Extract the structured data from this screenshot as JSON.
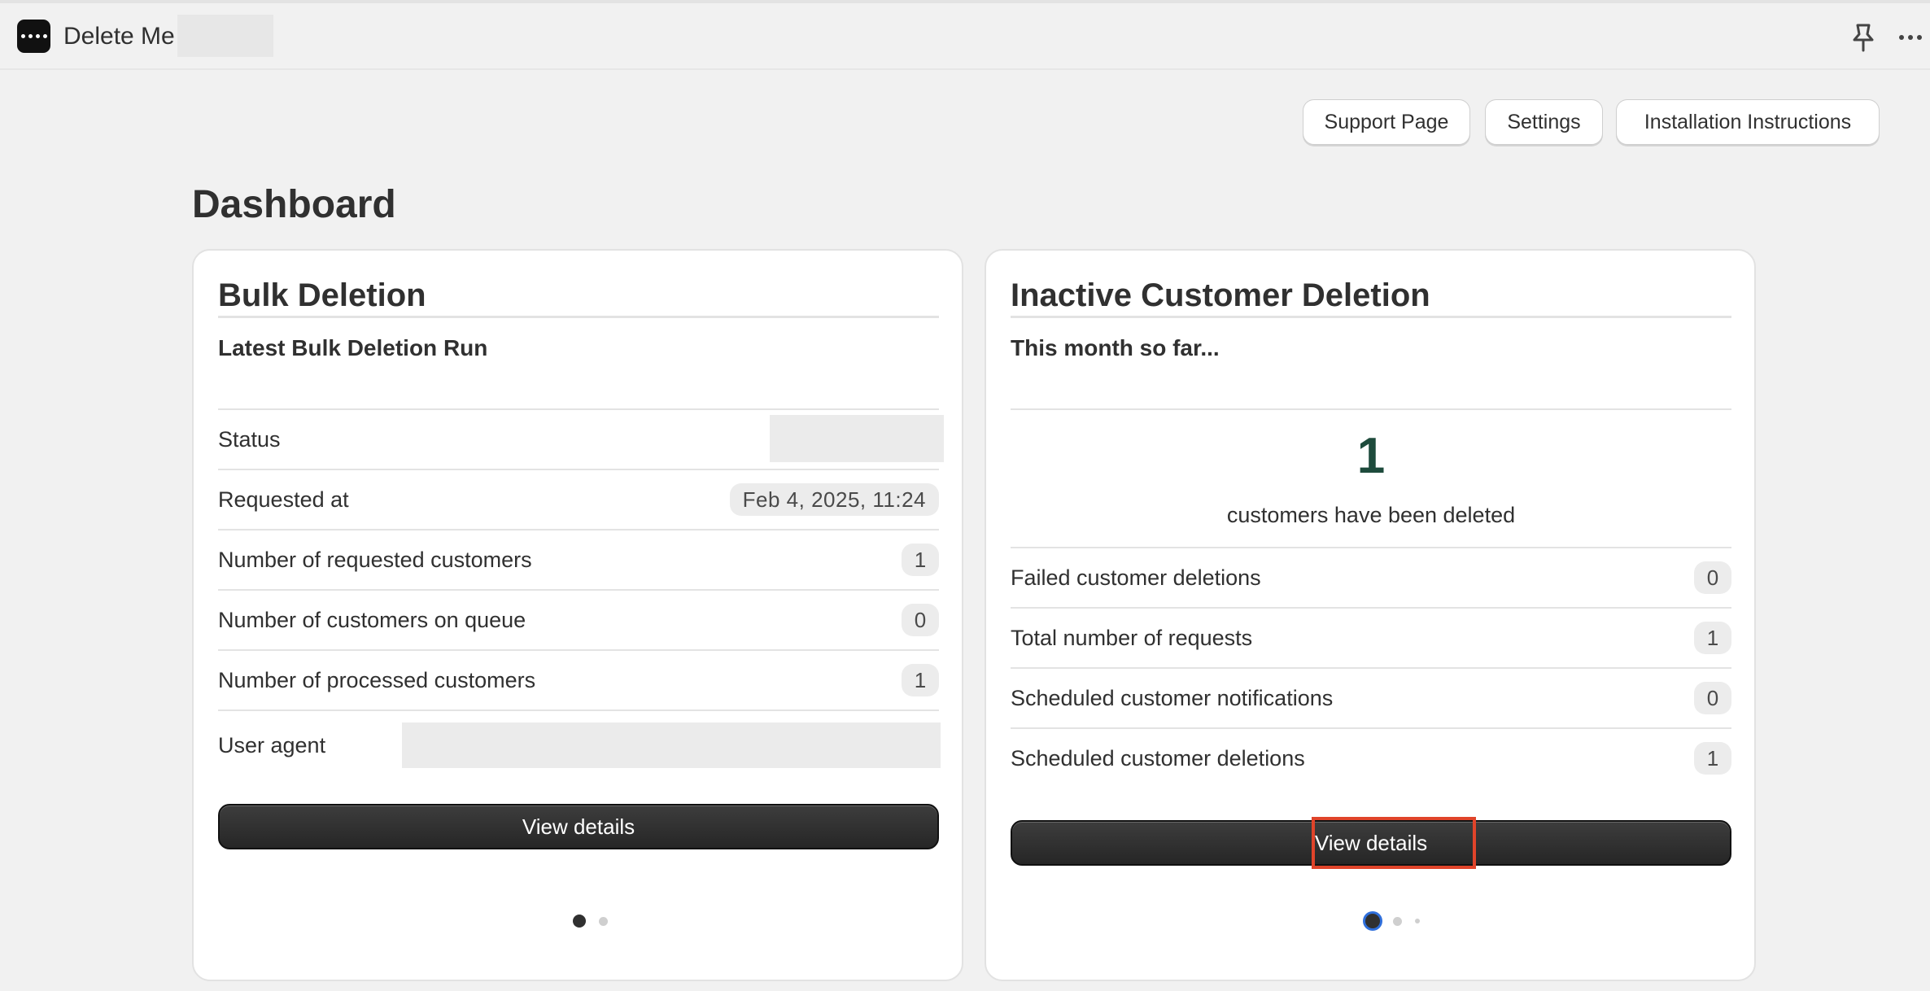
{
  "app": {
    "title": "Delete Me"
  },
  "header_actions": {
    "support_label": "Support Page",
    "settings_label": "Settings",
    "installation_label": "Installation Instructions"
  },
  "page": {
    "title": "Dashboard"
  },
  "bulk_card": {
    "title": "Bulk Deletion",
    "subtitle": "Latest Bulk Deletion Run",
    "rows": [
      {
        "label": "Status",
        "value": ""
      },
      {
        "label": "Requested at",
        "value": "Feb 4, 2025, 11:24"
      },
      {
        "label": "Number of requested customers",
        "value": "1"
      },
      {
        "label": "Number of customers on queue",
        "value": "0"
      },
      {
        "label": "Number of processed customers",
        "value": "1"
      },
      {
        "label": "User agent",
        "value": ""
      }
    ],
    "button_label": "View details"
  },
  "inactive_card": {
    "title": "Inactive Customer Deletion",
    "subtitle": "This month so far...",
    "big_number": "1",
    "big_caption": "customers have been deleted",
    "rows": [
      {
        "label": "Failed customer deletions",
        "value": "0"
      },
      {
        "label": "Total number of requests",
        "value": "1"
      },
      {
        "label": "Scheduled customer notifications",
        "value": "0"
      },
      {
        "label": "Scheduled customer deletions",
        "value": "1"
      }
    ],
    "button_label": "View details"
  },
  "colors": {
    "highlight": "#e0442a",
    "big_number": "#1e4b3c",
    "dot_focus": "#2f6fdb"
  }
}
